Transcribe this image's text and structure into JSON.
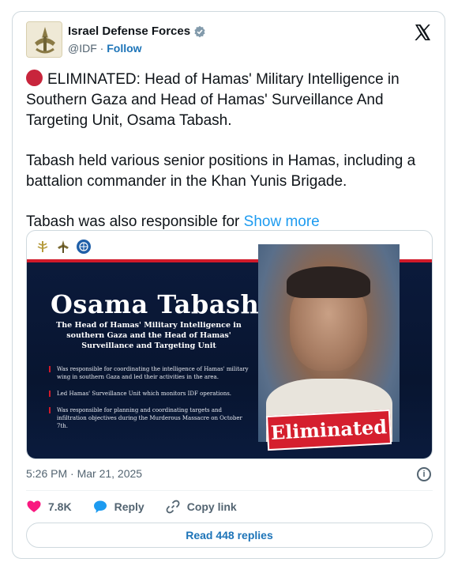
{
  "author": {
    "name": "Israel Defense Forces",
    "handle": "@IDF",
    "separator": "·",
    "follow_label": "Follow"
  },
  "tweet": {
    "para1": "ELIMINATED: Head of Hamas' Military Intelligence in Southern Gaza and Head of Hamas' Surveillance And Targeting Unit, Osama Tabash.",
    "para2": "Tabash held various senior positions in Hamas, including a battalion commander in the Khan Yunis Brigade.",
    "para3": "Tabash was also responsible for",
    "show_more": "Show more"
  },
  "media": {
    "name": "Osama Tabash",
    "subtitle": "The Head of Hamas' Military Intelligence in southern Gaza and the Head of Hamas' Surveillance and Targeting Unit",
    "bullets": [
      "Was responsible for coordinating the intelligence of Hamas' military wing in southern Gaza and led their activities in the area.",
      "Led Hamas' Surveillance Unit which monitors IDF operations.",
      "Was responsible for planning and coordinating targets and infiltration objectives during the Murderous Massacre on October 7th."
    ],
    "stamp": "Eliminated"
  },
  "meta": {
    "timestamp": "5:26 PM · Mar 21, 2025"
  },
  "actions": {
    "likes": "7.8K",
    "reply_label": "Reply",
    "copy_link_label": "Copy link"
  },
  "replies_button": "Read 448 replies",
  "colors": {
    "accent": "#1d9bf0",
    "like": "#f91880",
    "red_dot": "#c8253c",
    "panel_navy": "#0b1a3b"
  }
}
